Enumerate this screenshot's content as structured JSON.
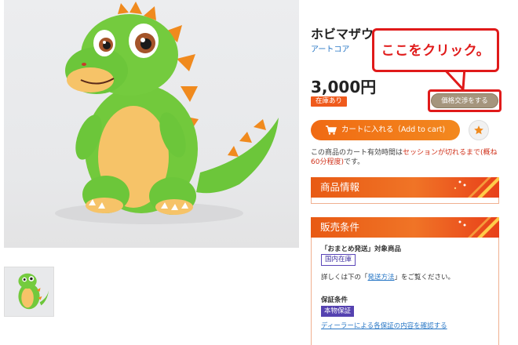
{
  "product": {
    "title": "ホビマザウルス",
    "brand": "アートコア",
    "price": "3,000円",
    "stock": "在庫あり"
  },
  "buttons": {
    "negotiate": "価格交渉をする",
    "cart": "カートに入れる（Add to cart)"
  },
  "callout": {
    "text": "ここをクリック。"
  },
  "session_note": {
    "prefix": "この商品のカート有効時間は",
    "highlight1": "セッションが切れるまで",
    "middle": "(概ね60分程度)",
    "suffix": "です。"
  },
  "sections": {
    "info_title": "商品情報",
    "sales_title": "販売条件"
  },
  "sales": {
    "bundle_label": "「おまとめ発送」対象商品",
    "domestic_tag": "国内在庫",
    "detail_prefix": "詳しくは下の「",
    "detail_link": "発送方法",
    "detail_suffix": "」をご覧ください。",
    "warranty_label": "保証条件",
    "auth_tag": "本物保証",
    "dealer_link": "ディーラーによる各保証の内容を確認する"
  },
  "colors": {
    "accent_orange": "#f06a13",
    "callout_red": "#e01a1a",
    "negotiate_tan": "#a5957d",
    "tag_purple": "#5542b0",
    "link_blue": "#2a78c6"
  },
  "icons": [
    "cart-icon",
    "star-icon"
  ]
}
